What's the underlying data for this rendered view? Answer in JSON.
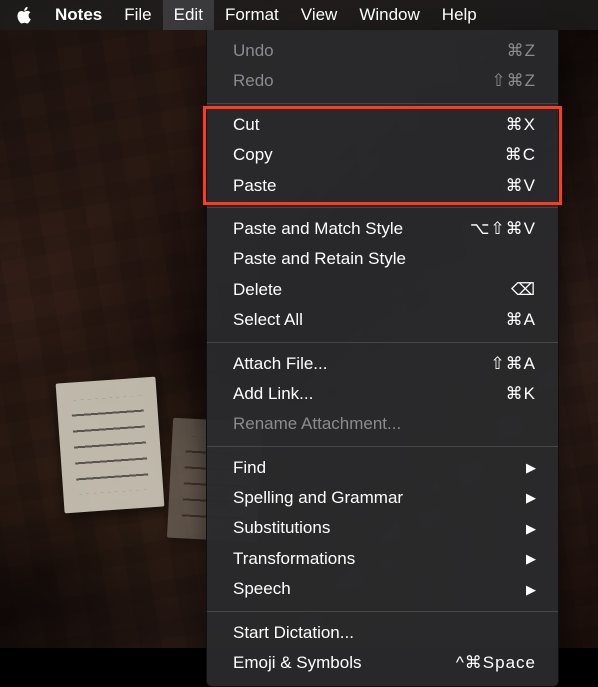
{
  "menubar": {
    "app": "Notes",
    "items": [
      "File",
      "Edit",
      "Format",
      "View",
      "Window",
      "Help"
    ],
    "open_index": 1
  },
  "edit_menu": {
    "groups": [
      [
        {
          "id": "undo",
          "label": "Undo",
          "shortcut": "⌘Z",
          "disabled": true
        },
        {
          "id": "redo",
          "label": "Redo",
          "shortcut": "⇧⌘Z",
          "disabled": true
        }
      ],
      [
        {
          "id": "cut",
          "label": "Cut",
          "shortcut": "⌘X"
        },
        {
          "id": "copy",
          "label": "Copy",
          "shortcut": "⌘C"
        },
        {
          "id": "paste",
          "label": "Paste",
          "shortcut": "⌘V"
        }
      ],
      [
        {
          "id": "paste-match-style",
          "label": "Paste and Match Style",
          "shortcut": "⌥⇧⌘V"
        },
        {
          "id": "paste-retain-style",
          "label": "Paste and Retain Style",
          "shortcut": ""
        },
        {
          "id": "delete",
          "label": "Delete",
          "shortcut": "⌫"
        },
        {
          "id": "select-all",
          "label": "Select All",
          "shortcut": "⌘A"
        }
      ],
      [
        {
          "id": "attach-file",
          "label": "Attach File...",
          "shortcut": "⇧⌘A"
        },
        {
          "id": "add-link",
          "label": "Add Link...",
          "shortcut": "⌘K"
        },
        {
          "id": "rename-attachment",
          "label": "Rename Attachment...",
          "shortcut": "",
          "disabled": true
        }
      ],
      [
        {
          "id": "find",
          "label": "Find",
          "submenu": true
        },
        {
          "id": "spelling-grammar",
          "label": "Spelling and Grammar",
          "submenu": true
        },
        {
          "id": "substitutions",
          "label": "Substitutions",
          "submenu": true
        },
        {
          "id": "transformations",
          "label": "Transformations",
          "submenu": true
        },
        {
          "id": "speech",
          "label": "Speech",
          "submenu": true
        }
      ],
      [
        {
          "id": "start-dictation",
          "label": "Start Dictation...",
          "shortcut": ""
        },
        {
          "id": "emoji-symbols",
          "label": "Emoji & Symbols",
          "shortcut": "^⌘Space"
        }
      ]
    ]
  },
  "highlight": {
    "description": "Red rectangle highlighting Cut, Copy, Paste rows"
  }
}
